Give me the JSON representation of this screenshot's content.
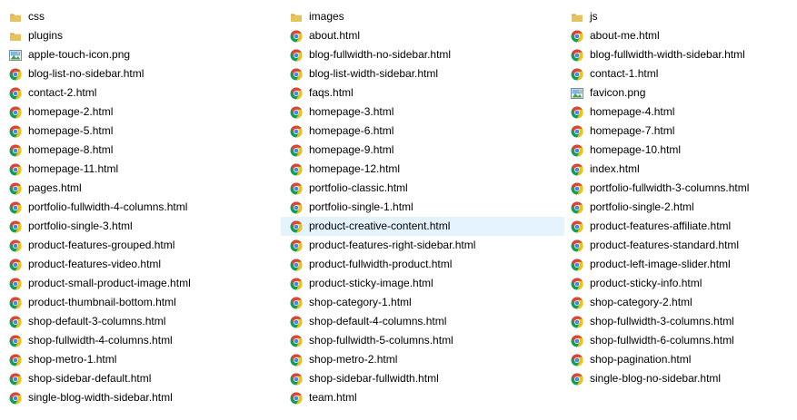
{
  "colors": {
    "folder": "#e8c35d",
    "folder_dark": "#d6a93a",
    "chrome_red": "#db4437",
    "chrome_yellow": "#f4c20d",
    "chrome_green": "#0f9d58",
    "chrome_blue": "#4285f4",
    "selection": "#e5f3ff"
  },
  "columns": [
    {
      "items": [
        {
          "name": "css",
          "icon": "folder-icon"
        },
        {
          "name": "plugins",
          "icon": "folder-icon"
        },
        {
          "name": "apple-touch-icon.png",
          "icon": "image-file-icon"
        },
        {
          "name": "blog-list-no-sidebar.html",
          "icon": "chrome-icon"
        },
        {
          "name": "contact-2.html",
          "icon": "chrome-icon"
        },
        {
          "name": "homepage-2.html",
          "icon": "chrome-icon"
        },
        {
          "name": "homepage-5.html",
          "icon": "chrome-icon"
        },
        {
          "name": "homepage-8.html",
          "icon": "chrome-icon"
        },
        {
          "name": "homepage-11.html",
          "icon": "chrome-icon"
        },
        {
          "name": "pages.html",
          "icon": "chrome-icon"
        },
        {
          "name": "portfolio-fullwidth-4-columns.html",
          "icon": "chrome-icon"
        },
        {
          "name": "portfolio-single-3.html",
          "icon": "chrome-icon"
        },
        {
          "name": "product-features-grouped.html",
          "icon": "chrome-icon"
        },
        {
          "name": "product-features-video.html",
          "icon": "chrome-icon"
        },
        {
          "name": "product-small-product-image.html",
          "icon": "chrome-icon"
        },
        {
          "name": "product-thumbnail-bottom.html",
          "icon": "chrome-icon"
        },
        {
          "name": "shop-default-3-columns.html",
          "icon": "chrome-icon"
        },
        {
          "name": "shop-fullwidth-4-columns.html",
          "icon": "chrome-icon"
        },
        {
          "name": "shop-metro-1.html",
          "icon": "chrome-icon"
        },
        {
          "name": "shop-sidebar-default.html",
          "icon": "chrome-icon"
        },
        {
          "name": "single-blog-width-sidebar.html",
          "icon": "chrome-icon"
        }
      ]
    },
    {
      "items": [
        {
          "name": "images",
          "icon": "folder-icon"
        },
        {
          "name": "about.html",
          "icon": "chrome-icon"
        },
        {
          "name": "blog-fullwidth-no-sidebar.html",
          "icon": "chrome-icon"
        },
        {
          "name": "blog-list-width-sidebar.html",
          "icon": "chrome-icon"
        },
        {
          "name": "faqs.html",
          "icon": "chrome-icon"
        },
        {
          "name": "homepage-3.html",
          "icon": "chrome-icon"
        },
        {
          "name": "homepage-6.html",
          "icon": "chrome-icon"
        },
        {
          "name": "homepage-9.html",
          "icon": "chrome-icon"
        },
        {
          "name": "homepage-12.html",
          "icon": "chrome-icon"
        },
        {
          "name": "portfolio-classic.html",
          "icon": "chrome-icon"
        },
        {
          "name": "portfolio-single-1.html",
          "icon": "chrome-icon"
        },
        {
          "name": "product-creative-content.html",
          "icon": "chrome-icon",
          "selected": true
        },
        {
          "name": "product-features-right-sidebar.html",
          "icon": "chrome-icon"
        },
        {
          "name": "product-fullwidth-product.html",
          "icon": "chrome-icon"
        },
        {
          "name": "product-sticky-image.html",
          "icon": "chrome-icon"
        },
        {
          "name": "shop-category-1.html",
          "icon": "chrome-icon"
        },
        {
          "name": "shop-default-4-columns.html",
          "icon": "chrome-icon"
        },
        {
          "name": "shop-fullwidth-5-columns.html",
          "icon": "chrome-icon"
        },
        {
          "name": "shop-metro-2.html",
          "icon": "chrome-icon"
        },
        {
          "name": "shop-sidebar-fullwidth.html",
          "icon": "chrome-icon"
        },
        {
          "name": "team.html",
          "icon": "chrome-icon"
        }
      ]
    },
    {
      "items": [
        {
          "name": "js",
          "icon": "folder-icon"
        },
        {
          "name": "about-me.html",
          "icon": "chrome-icon"
        },
        {
          "name": "blog-fullwidth-width-sidebar.html",
          "icon": "chrome-icon"
        },
        {
          "name": "contact-1.html",
          "icon": "chrome-icon"
        },
        {
          "name": "favicon.png",
          "icon": "image-file-icon"
        },
        {
          "name": "homepage-4.html",
          "icon": "chrome-icon"
        },
        {
          "name": "homepage-7.html",
          "icon": "chrome-icon"
        },
        {
          "name": "homepage-10.html",
          "icon": "chrome-icon"
        },
        {
          "name": "index.html",
          "icon": "chrome-icon"
        },
        {
          "name": "portfolio-fullwidth-3-columns.html",
          "icon": "chrome-icon"
        },
        {
          "name": "portfolio-single-2.html",
          "icon": "chrome-icon"
        },
        {
          "name": "product-features-affiliate.html",
          "icon": "chrome-icon"
        },
        {
          "name": "product-features-standard.html",
          "icon": "chrome-icon"
        },
        {
          "name": "product-left-image-slider.html",
          "icon": "chrome-icon"
        },
        {
          "name": "product-sticky-info.html",
          "icon": "chrome-icon"
        },
        {
          "name": "shop-category-2.html",
          "icon": "chrome-icon"
        },
        {
          "name": "shop-fullwidth-3-columns.html",
          "icon": "chrome-icon"
        },
        {
          "name": "shop-fullwidth-6-columns.html",
          "icon": "chrome-icon"
        },
        {
          "name": "shop-pagination.html",
          "icon": "chrome-icon"
        },
        {
          "name": "single-blog-no-sidebar.html",
          "icon": "chrome-icon"
        }
      ]
    }
  ]
}
